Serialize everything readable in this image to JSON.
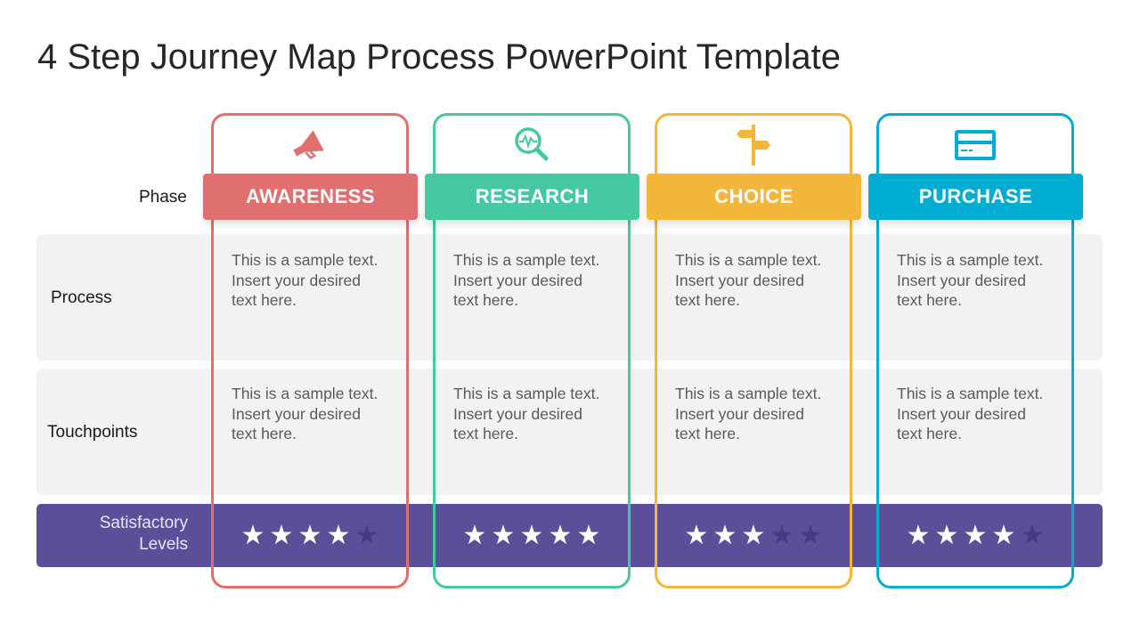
{
  "slide": {
    "title": "4 Step Journey Map Process PowerPoint Template",
    "row_labels": {
      "phase": "Phase",
      "process": "Process",
      "touchpoints": "Touchpoints",
      "satisfaction_line1": "Satisfactory",
      "satisfaction_line2": "Levels"
    },
    "max_stars": 5,
    "steps": [
      {
        "phase": "AWARENESS",
        "icon": "megaphone-icon",
        "color": "#e07070",
        "process_text": [
          "This is a sample text.",
          "Insert your desired",
          "text here."
        ],
        "touchpoints_text": [
          "This is a sample text.",
          "Insert your desired",
          "text here."
        ],
        "rating": 4
      },
      {
        "phase": "RESEARCH",
        "icon": "magnifier-pulse-icon",
        "color": "#45c9a0",
        "process_text": [
          "This is a sample text.",
          "Insert your desired",
          "text here."
        ],
        "touchpoints_text": [
          "This is a sample text.",
          "Insert your desired",
          "text here."
        ],
        "rating": 5
      },
      {
        "phase": "CHOICE",
        "icon": "signpost-icon",
        "color": "#f4b63a",
        "process_text": [
          "This is a sample text.",
          "Insert your desired",
          "text here."
        ],
        "touchpoints_text": [
          "This is a sample text.",
          "Insert your desired",
          "text here."
        ],
        "rating": 3
      },
      {
        "phase": "PURCHASE",
        "icon": "credit-card-icon",
        "color": "#00acd1",
        "process_text": [
          "This is a sample text.",
          "Insert your desired",
          "text here."
        ],
        "touchpoints_text": [
          "This is a sample text.",
          "Insert your desired",
          "text here."
        ],
        "rating": 4
      }
    ]
  }
}
